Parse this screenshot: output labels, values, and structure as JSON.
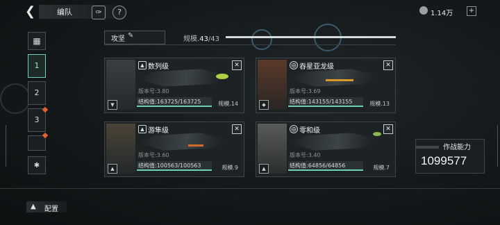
{
  "topbar": {
    "title": "编队",
    "back_icon": "chevron-left-icon",
    "currency_amount": "1.14万",
    "add_label": "+"
  },
  "side": {
    "items": [
      {
        "label": "1"
      },
      {
        "label": "2"
      },
      {
        "label": "3"
      }
    ]
  },
  "fleet": {
    "name": "攻坚",
    "scale_label": "规模.",
    "scale_current": "43",
    "scale_sep": "/",
    "scale_max": "43"
  },
  "ships": [
    {
      "name": "数列级",
      "version": "版本号:3.80",
      "structure": "结构值:163725/163725",
      "structure_fraction": 1.0,
      "scale": "规模.14",
      "close": "✕",
      "accent": "#c6f04a"
    },
    {
      "name": "吞星亚龙级",
      "version": "版本号:3.69",
      "structure": "结构值:143155/143155",
      "structure_fraction": 1.0,
      "scale": "规模.13",
      "close": "✕",
      "accent": "#d99a2a"
    },
    {
      "name": "游隼级",
      "version": "版本号:3.60",
      "structure": "结构值:100563/100563",
      "structure_fraction": 1.0,
      "scale": "规模.9",
      "close": "✕",
      "accent": "#d26a2a"
    },
    {
      "name": "零和级",
      "version": "版本号:3.40",
      "structure": "结构值:64856/64856",
      "structure_fraction": 1.0,
      "scale": "规模.7",
      "close": "✕",
      "accent": "#9ad25a"
    }
  ],
  "power": {
    "label": "作战能力",
    "value": "1099577"
  },
  "bottom": {
    "config_label": "配置"
  }
}
